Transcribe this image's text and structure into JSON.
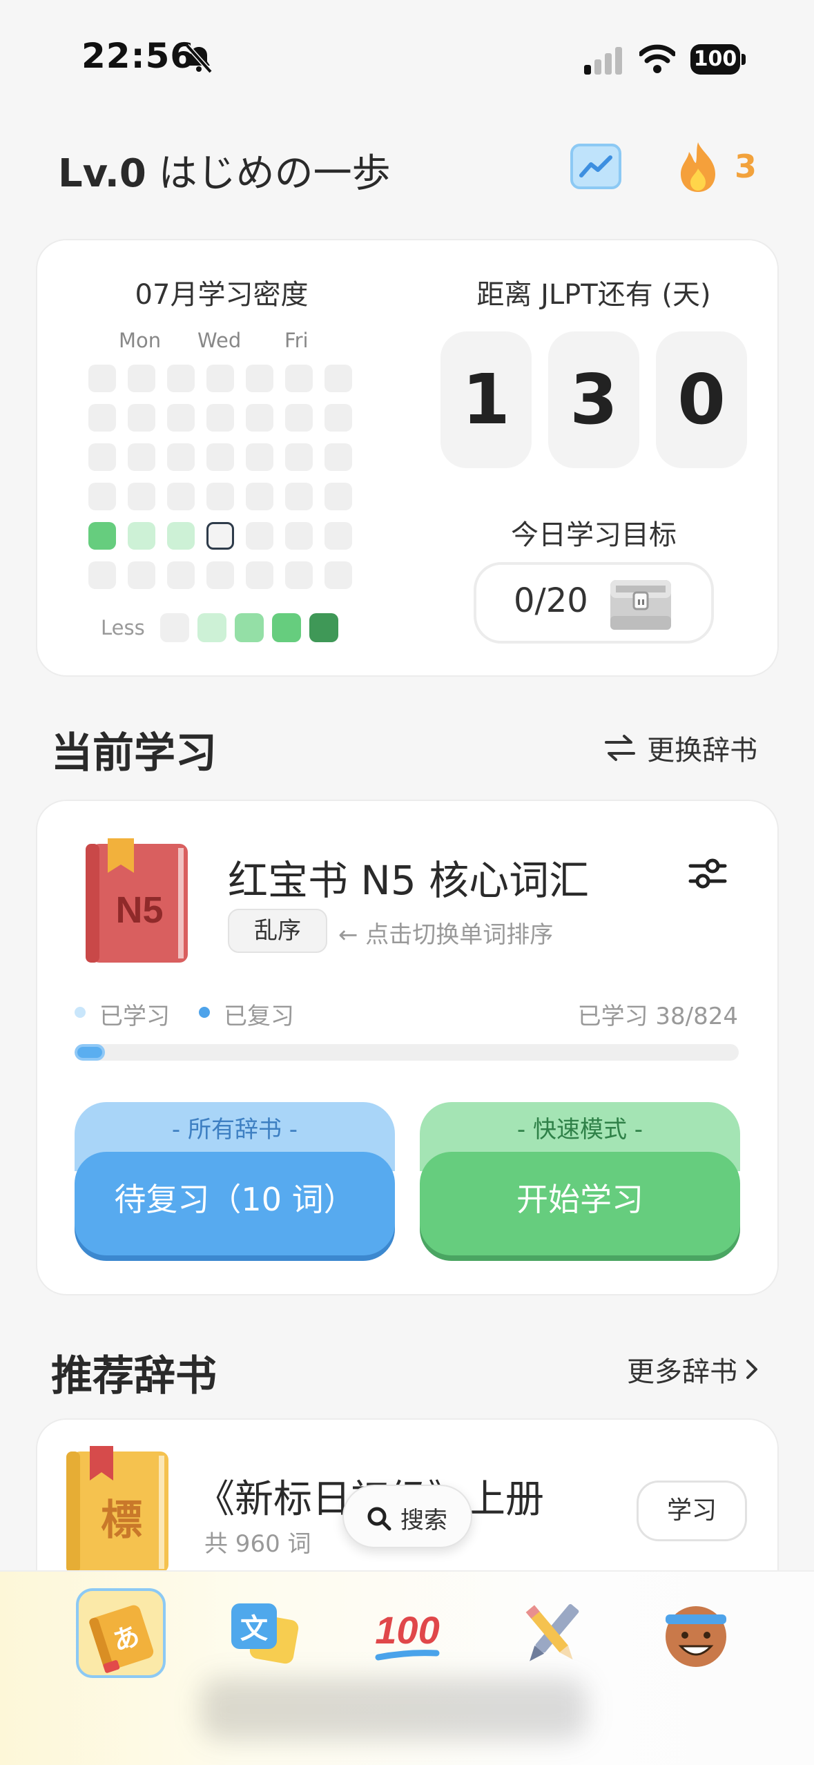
{
  "status_bar": {
    "time": "22:56",
    "battery": "100"
  },
  "header": {
    "level_label": "Lv.0",
    "level_name": "はじめの一歩",
    "streak": "3"
  },
  "stats": {
    "density_title": "07月学习密度",
    "day_labels": [
      "Mon",
      "Wed",
      "Fri"
    ],
    "legend_less": "Less",
    "jlpt_title": "距离 JLPT还有 (天)",
    "jlpt_days": [
      "1",
      "3",
      "0"
    ],
    "goal_title": "今日学习目标",
    "goal_value": "0/20"
  },
  "current": {
    "section_title": "当前学习",
    "change_book": "更换辞书",
    "book_cover_text": "N5",
    "book_title": "红宝书 N5 核心词汇",
    "order_tag": "乱序",
    "order_hint": "← 点击切换单词排序",
    "legend_learned": "已学习",
    "legend_reviewed": "已复习",
    "progress_text": "已学习 38/824",
    "progress_fraction": 0.046,
    "review_top": "- 所有辞书 -",
    "review_button": "待复习（10 词）",
    "start_top": "- 快速模式 -",
    "start_button": "开始学习"
  },
  "recommended": {
    "section_title": "推荐辞书",
    "more_link": "更多辞书",
    "book_cover_text": "標",
    "book_title": "《新标日初级》上册",
    "book_count": "共 960 词",
    "learn_button": "学习",
    "search_label": "搜索"
  },
  "tabbar": {
    "tab_books_glyph": "あ",
    "tab_translate_glyph": "文",
    "tab_score_text": "100"
  },
  "colors": {
    "green_accent": "#66cd7e",
    "blue_accent": "#57aaef",
    "streak_orange": "#f2a23c"
  }
}
